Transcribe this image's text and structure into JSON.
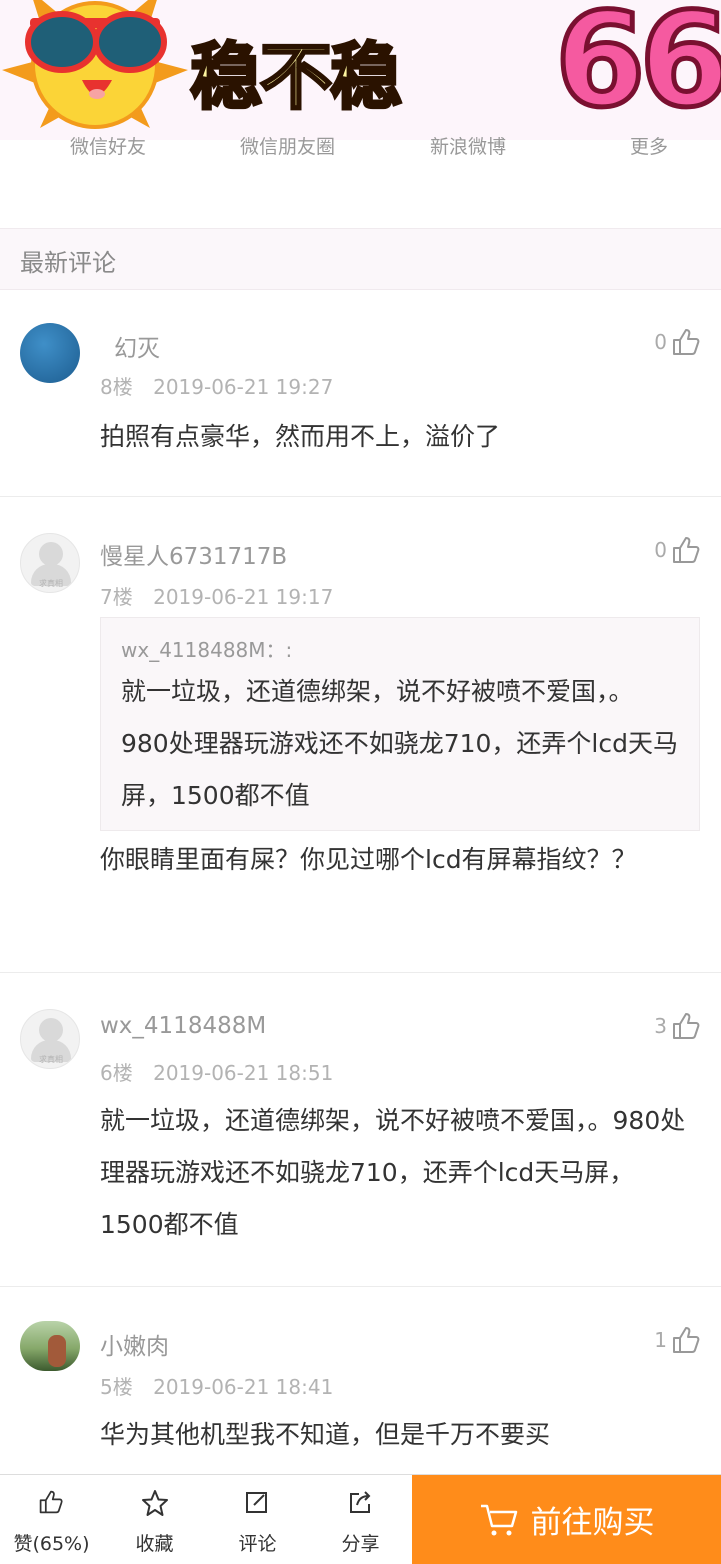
{
  "share": {
    "items": [
      "微信好友",
      "微信朋友圈",
      "新浪微博",
      "更多"
    ],
    "banner_slogan": "稳不稳",
    "banner_number": "66"
  },
  "section": {
    "title": "最新评论"
  },
  "comments": [
    {
      "user": "幻灭",
      "floor": "8楼",
      "time": "2019-06-21 19:27",
      "likes": "0",
      "text": "拍照有点豪华，然而用不上，溢价了",
      "avatar": "blue"
    },
    {
      "user": "慢星人6731717B",
      "floor": "7楼",
      "time": "2019-06-21 19:17",
      "likes": "0",
      "quote_user": "wx_4118488M：:",
      "quote_text": "就一垃圾，还道德绑架，说不好被喷不爱国，。980处理器玩游戏还不如骁龙710，还弄个lcd天马屏，1500都不值",
      "text": "你眼睛里面有屎？你见过哪个lcd有屏幕指纹？？",
      "avatar": "default",
      "avatar_caption": "求真相"
    },
    {
      "user": "wx_4118488M",
      "floor": "6楼",
      "time": "2019-06-21 18:51",
      "likes": "3",
      "text": "就一垃圾，还道德绑架，说不好被喷不爱国，。980处理器玩游戏还不如骁龙710，还弄个lcd天马屏，1500都不值",
      "avatar": "default",
      "avatar_caption": "求真相"
    },
    {
      "user": "小嫩肉",
      "floor": "5楼",
      "time": "2019-06-21 18:41",
      "likes": "1",
      "text": "华为其他机型我不知道，但是千万不要买",
      "avatar": "photo"
    }
  ],
  "toolbar": {
    "like": "赞(65%)",
    "favorite": "收藏",
    "comment": "评论",
    "share": "分享",
    "buy": "前往购买"
  },
  "colors": {
    "accent": "#ff8c1a",
    "banner_bg": "#fdf5fb"
  }
}
